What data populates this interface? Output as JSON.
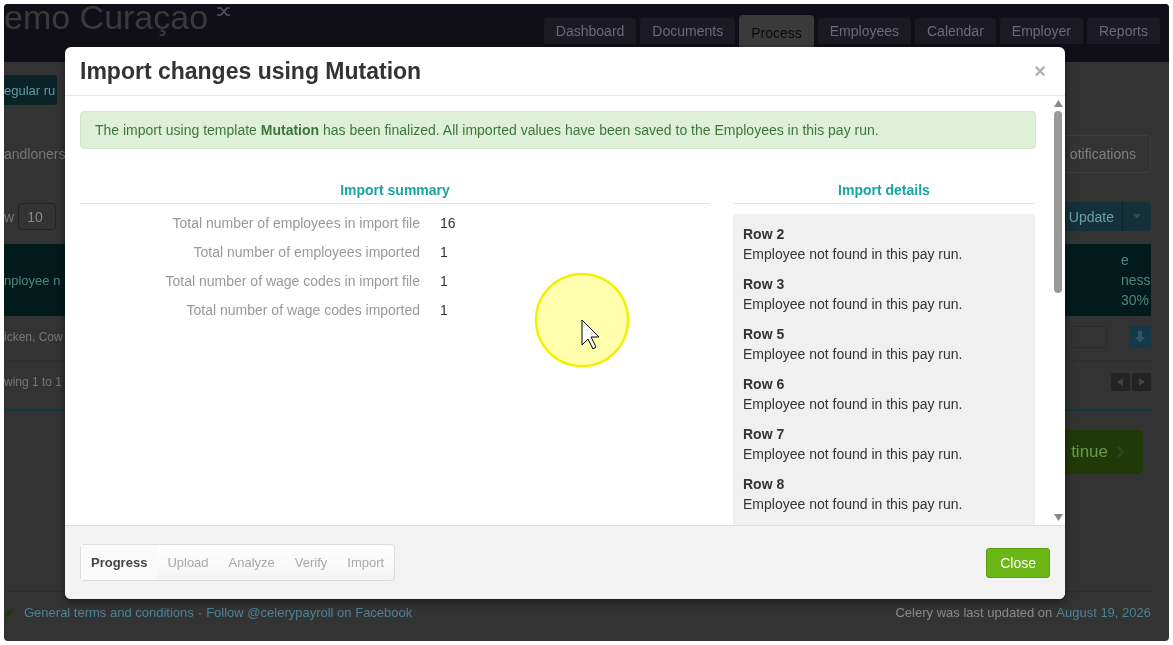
{
  "background_page": {
    "title": "emo Curaçao",
    "nav_tabs": [
      {
        "label": "Dashboard",
        "selected": false
      },
      {
        "label": "Documents",
        "selected": false
      },
      {
        "label": "Process",
        "selected": true
      },
      {
        "label": "Employees",
        "selected": false
      },
      {
        "label": "Calendar",
        "selected": false
      },
      {
        "label": "Employer",
        "selected": false
      },
      {
        "label": "Reports",
        "selected": false
      }
    ],
    "run_button": "egular ru",
    "filter_label": "andloners",
    "notifications_button": "otifications",
    "show_label": "w",
    "page_size": "10",
    "update_button": "Update",
    "table": {
      "column_1": "nployee n",
      "column_2": [
        "e",
        "ness",
        "30%"
      ],
      "row": "icken, Cow"
    },
    "info": "wing 1 to 1",
    "continue_button": "tinue",
    "footer": {
      "links": [
        "General terms and conditions",
        "Follow @celerypayroll on Facebook"
      ],
      "separator": "·",
      "updated_text": "Celery was last updated on",
      "updated_date": "August 19, 2026"
    }
  },
  "modal": {
    "title": "Import changes using Mutation",
    "close": "×",
    "alert": "The import using template **Mutation** has been finalized. All imported values have been saved to the Employees in this pay run.",
    "summary": {
      "heading": "Import summary",
      "rows": [
        {
          "label": "Total number of employees in import file",
          "value": "16"
        },
        {
          "label": "Total number of employees imported",
          "value": "1"
        },
        {
          "label": "Total number of wage codes in import file",
          "value": "1"
        },
        {
          "label": "Total number of wage codes imported",
          "value": "1"
        }
      ]
    },
    "details": {
      "heading": "Import details",
      "items": [
        {
          "row": "Row 2",
          "message": "Employee not found in this pay run."
        },
        {
          "row": "Row 3",
          "message": "Employee not found in this pay run."
        },
        {
          "row": "Row 5",
          "message": "Employee not found in this pay run."
        },
        {
          "row": "Row 6",
          "message": "Employee not found in this pay run."
        },
        {
          "row": "Row 7",
          "message": "Employee not found in this pay run."
        },
        {
          "row": "Row 8",
          "message": "Employee not found in this pay run."
        }
      ]
    },
    "steps": [
      {
        "label": "Progress",
        "selected": true
      },
      {
        "label": "Upload",
        "selected": false
      },
      {
        "label": "Analyze",
        "selected": false
      },
      {
        "label": "Verify",
        "selected": false
      },
      {
        "label": "Import",
        "selected": false
      }
    ],
    "close_button": "Close"
  }
}
